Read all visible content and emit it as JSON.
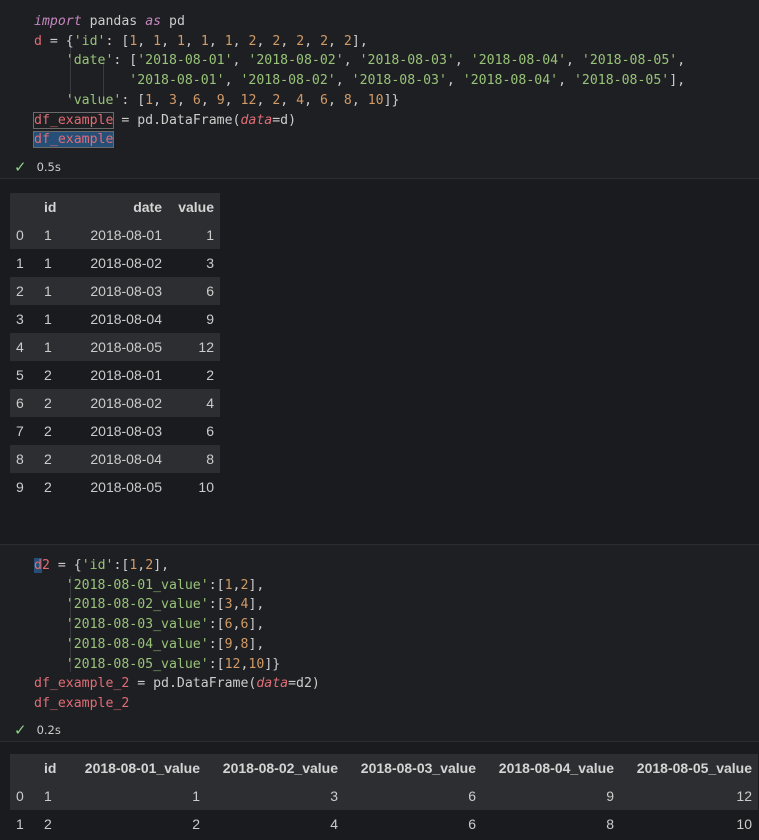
{
  "cell1": {
    "status_time": "0.5s",
    "output": {
      "columns": [
        "",
        "id",
        "date",
        "value"
      ],
      "rows": [
        [
          "0",
          "1",
          "2018-08-01",
          "1"
        ],
        [
          "1",
          "1",
          "2018-08-02",
          "3"
        ],
        [
          "2",
          "1",
          "2018-08-03",
          "6"
        ],
        [
          "3",
          "1",
          "2018-08-04",
          "9"
        ],
        [
          "4",
          "1",
          "2018-08-05",
          "12"
        ],
        [
          "5",
          "2",
          "2018-08-01",
          "2"
        ],
        [
          "6",
          "2",
          "2018-08-02",
          "4"
        ],
        [
          "7",
          "2",
          "2018-08-03",
          "6"
        ],
        [
          "8",
          "2",
          "2018-08-04",
          "8"
        ],
        [
          "9",
          "2",
          "2018-08-05",
          "10"
        ]
      ]
    }
  },
  "cell2": {
    "status_time": "0.2s",
    "output": {
      "columns": [
        "",
        "id",
        "2018-08-01_value",
        "2018-08-02_value",
        "2018-08-03_value",
        "2018-08-04_value",
        "2018-08-05_value"
      ],
      "rows": [
        [
          "0",
          "1",
          "1",
          "3",
          "6",
          "9",
          "12"
        ],
        [
          "1",
          "2",
          "2",
          "4",
          "6",
          "8",
          "10"
        ]
      ]
    }
  },
  "colors": {
    "background": "#1e1f22",
    "keyword": "#c586c0",
    "variable": "#e06c75",
    "string": "#98c379",
    "number": "#d19a66",
    "success_check": "#89d185"
  },
  "icons": {
    "status": "check-icon"
  }
}
